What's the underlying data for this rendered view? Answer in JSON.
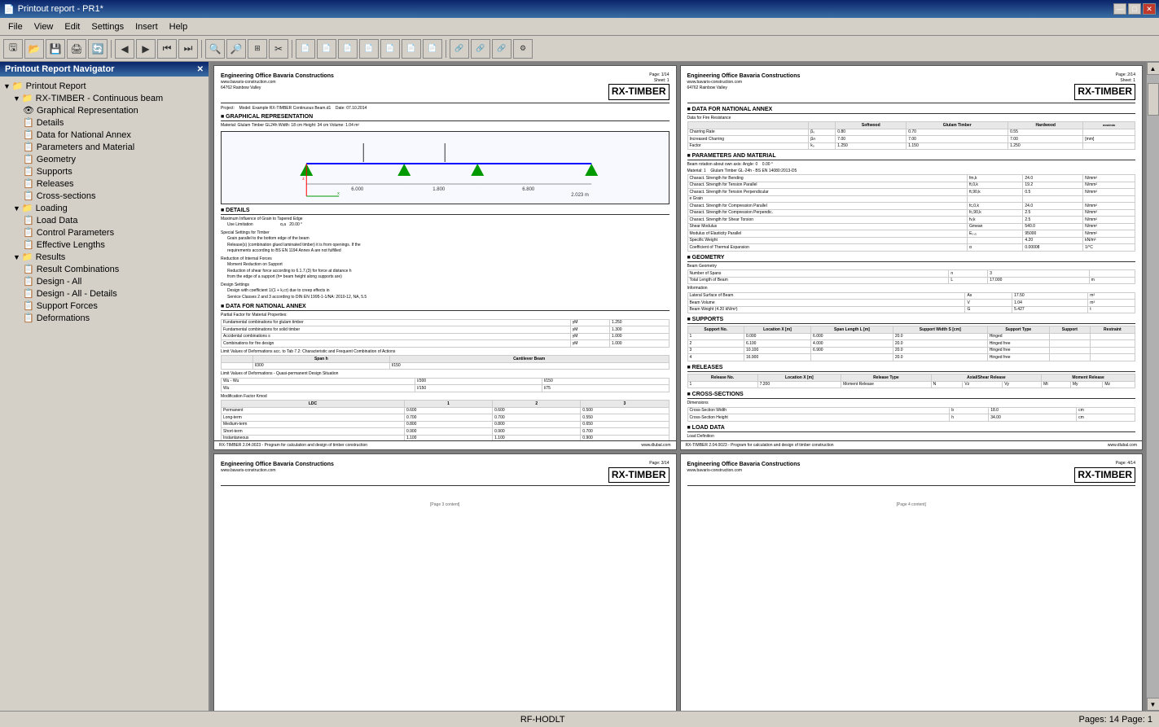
{
  "titleBar": {
    "title": "Printout report - PR1*",
    "icon": "📄",
    "controls": [
      "—",
      "□",
      "✕"
    ]
  },
  "menuBar": {
    "items": [
      "File",
      "View",
      "Edit",
      "Settings",
      "Insert",
      "Help"
    ]
  },
  "toolbar": {
    "groups": [
      [
        "🖫",
        "📂",
        "💾",
        "🖨",
        "🔄",
        "◀",
        "▶",
        "⏮",
        "⏭"
      ],
      [
        "🔍",
        "🔍",
        "🔧",
        "✂",
        "📋"
      ],
      [
        "📄",
        "📄",
        "📄",
        "📄",
        "📄",
        "📄",
        "📄"
      ],
      [
        "🔗",
        "🔗",
        "🔗",
        "⚙"
      ]
    ]
  },
  "sidebar": {
    "title": "Printout Report Navigator",
    "tree": [
      {
        "id": "root",
        "label": "Printout Report",
        "level": 0,
        "type": "root",
        "expanded": true
      },
      {
        "id": "rx-timber",
        "label": "RX-TIMBER - Continuous beam",
        "level": 1,
        "type": "folder",
        "expanded": true
      },
      {
        "id": "graphical",
        "label": "Graphical Representation",
        "level": 2,
        "type": "eye"
      },
      {
        "id": "details",
        "label": "Details",
        "level": 2,
        "type": "page"
      },
      {
        "id": "national",
        "label": "Data for National Annex",
        "level": 2,
        "type": "page"
      },
      {
        "id": "params",
        "label": "Parameters and Material",
        "level": 2,
        "type": "page"
      },
      {
        "id": "geometry",
        "label": "Geometry",
        "level": 2,
        "type": "page"
      },
      {
        "id": "supports",
        "label": "Supports",
        "level": 2,
        "type": "page"
      },
      {
        "id": "releases",
        "label": "Releases",
        "level": 2,
        "type": "page"
      },
      {
        "id": "cross-sections",
        "label": "Cross-sections",
        "level": 2,
        "type": "page"
      },
      {
        "id": "loading",
        "label": "Loading",
        "level": 1,
        "type": "folder",
        "expanded": true
      },
      {
        "id": "load-data",
        "label": "Load Data",
        "level": 2,
        "type": "page"
      },
      {
        "id": "control-params",
        "label": "Control Parameters",
        "level": 2,
        "type": "page"
      },
      {
        "id": "effective-lengths",
        "label": "Effective Lengths",
        "level": 2,
        "type": "page"
      },
      {
        "id": "results",
        "label": "Results",
        "level": 1,
        "type": "folder",
        "expanded": true
      },
      {
        "id": "result-combinations",
        "label": "Result Combinations",
        "level": 2,
        "type": "page"
      },
      {
        "id": "design-all",
        "label": "Design - All",
        "level": 2,
        "type": "page"
      },
      {
        "id": "design-all-details",
        "label": "Design - All - Details",
        "level": 2,
        "type": "page"
      },
      {
        "id": "support-forces",
        "label": "Support Forces",
        "level": 2,
        "type": "page"
      },
      {
        "id": "deformations",
        "label": "Deformations",
        "level": 2,
        "type": "page"
      }
    ]
  },
  "pages": [
    {
      "id": "page1",
      "pageNum": "1/14",
      "sheetNum": "1",
      "projectLabel": "Project:",
      "modelLabel": "Model: Example RX-TIMBER Continuous Beam.d1",
      "dateLabel": "Date: 07.10.2014",
      "company": "Engineering Office Bavaria Constructions",
      "website": "www.bavaris-construction.com",
      "address": "64762 Rainbow Valley",
      "logo": "RX-TIMBER",
      "sections": [
        {
          "title": "GRAPHICAL REPRESENTATION",
          "hasDot": true
        },
        {
          "title": "DETAILS",
          "hasDot": true
        },
        {
          "title": "DATA FOR NATIONAL ANNEX",
          "hasDot": true
        }
      ],
      "materialLine": "Material: Glulam Timber GL24h  Width: 18 cm  Height: 34 cm  Volume: 1.04 m²"
    },
    {
      "id": "page2",
      "pageNum": "2/14",
      "sheetNum": "1",
      "company": "Engineering Office Bavaria Constructions",
      "website": "www.bavaris-construction.com",
      "address": "64762 Rainbow Valley",
      "logo": "RX-TIMBER",
      "sections": [
        {
          "title": "DATA FOR NATIONAL ANNEX",
          "hasDot": true
        },
        {
          "title": "PARAMETERS AND MATERIAL",
          "hasDot": true
        },
        {
          "title": "GEOMETRY",
          "hasDot": true
        },
        {
          "title": "SUPPORTS",
          "hasDot": true
        },
        {
          "title": "RELEASES",
          "hasDot": true
        },
        {
          "title": "CROSS-SECTIONS",
          "hasDot": true
        },
        {
          "title": "LOAD DATA",
          "hasDot": true
        }
      ]
    },
    {
      "id": "page3",
      "pageNum": "3/14",
      "sheetNum": "",
      "company": "Engineering Office Bavaria Constructions",
      "website": "www.bavaris-construction.com",
      "logo": "RX-TIMBER"
    },
    {
      "id": "page4",
      "pageNum": "4/14",
      "sheetNum": "",
      "company": "Engineering Office Bavaria Constructions",
      "website": "www.bavaris-construction.com",
      "logo": "RX-TIMBER"
    }
  ],
  "statusBar": {
    "center": "RF-HODLT",
    "right": "Pages: 14      Page: 1"
  }
}
